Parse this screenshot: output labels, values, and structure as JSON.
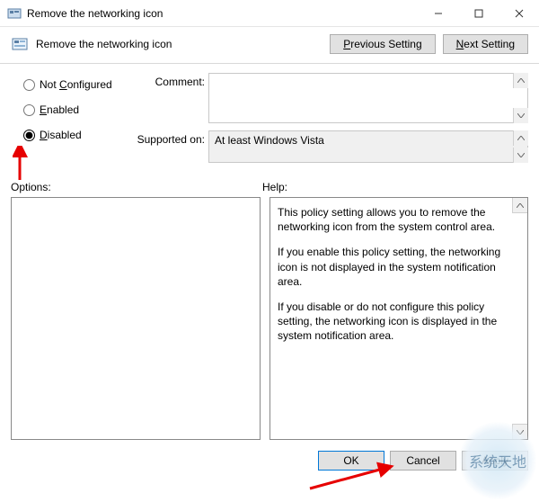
{
  "window": {
    "title": "Remove the networking icon"
  },
  "header": {
    "title": "Remove the networking icon",
    "prev": "Previous Setting",
    "next": "Next Setting"
  },
  "radios": {
    "not_configured": "Not Configured",
    "enabled": "Enabled",
    "disabled": "Disabled",
    "selected": "disabled"
  },
  "form": {
    "comment_label": "Comment:",
    "comment_value": "",
    "supported_label": "Supported on:",
    "supported_value": "At least Windows Vista"
  },
  "labels": {
    "options": "Options:",
    "help": "Help:"
  },
  "help": {
    "p1": "This policy setting allows you to remove the networking icon from the system control area.",
    "p2": "If you enable this policy setting, the networking icon is not displayed in the system notification area.",
    "p3": "If you disable or do not configure this policy setting, the networking icon is displayed in the system notification area."
  },
  "buttons": {
    "ok": "OK",
    "cancel": "Cancel",
    "apply": "Apply"
  },
  "watermark": "系统天地"
}
